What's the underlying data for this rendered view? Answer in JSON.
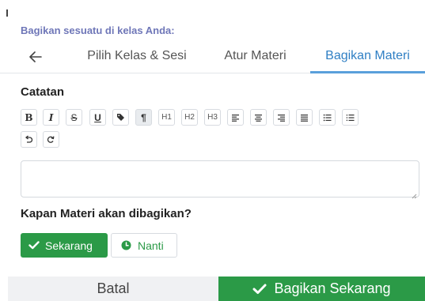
{
  "header": {
    "title": "Bagikan sesuatu di kelas Anda:"
  },
  "tabs": [
    {
      "label": "Pilih Kelas & Sesi"
    },
    {
      "label": "Atur Materi"
    },
    {
      "label": "Bagikan Materi"
    }
  ],
  "notes": {
    "label": "Catatan",
    "value": ""
  },
  "toolbar": {
    "buttons": [
      {
        "icon": "bold-icon",
        "text": "B"
      },
      {
        "icon": "italic-icon",
        "text": "I"
      },
      {
        "icon": "strikethrough-icon",
        "text": "S"
      },
      {
        "icon": "underline-icon",
        "text": "U"
      },
      {
        "icon": "tag-icon",
        "text": ""
      },
      {
        "icon": "paragraph-icon",
        "text": "¶"
      },
      {
        "icon": "heading-1-icon",
        "text": "H1"
      },
      {
        "icon": "heading-2-icon",
        "text": "H2"
      },
      {
        "icon": "heading-3-icon",
        "text": "H3"
      },
      {
        "icon": "align-left-icon",
        "text": ""
      },
      {
        "icon": "align-center-icon",
        "text": ""
      },
      {
        "icon": "align-right-icon",
        "text": ""
      },
      {
        "icon": "align-justify-icon",
        "text": ""
      },
      {
        "icon": "bullet-list-icon",
        "text": ""
      },
      {
        "icon": "numbered-list-icon",
        "text": ""
      },
      {
        "icon": "undo-icon",
        "text": ""
      },
      {
        "icon": "redo-icon",
        "text": ""
      }
    ]
  },
  "schedule": {
    "question": "Kapan Materi akan dibagikan?",
    "now_label": "Sekarang",
    "later_label": "Nanti"
  },
  "footer": {
    "cancel_label": "Batal",
    "share_label": "Bagikan Sekarang"
  },
  "colors": {
    "accent_green": "#2b9a47",
    "active_tab": "#2f7fc4",
    "header_text": "#6f77b8"
  }
}
